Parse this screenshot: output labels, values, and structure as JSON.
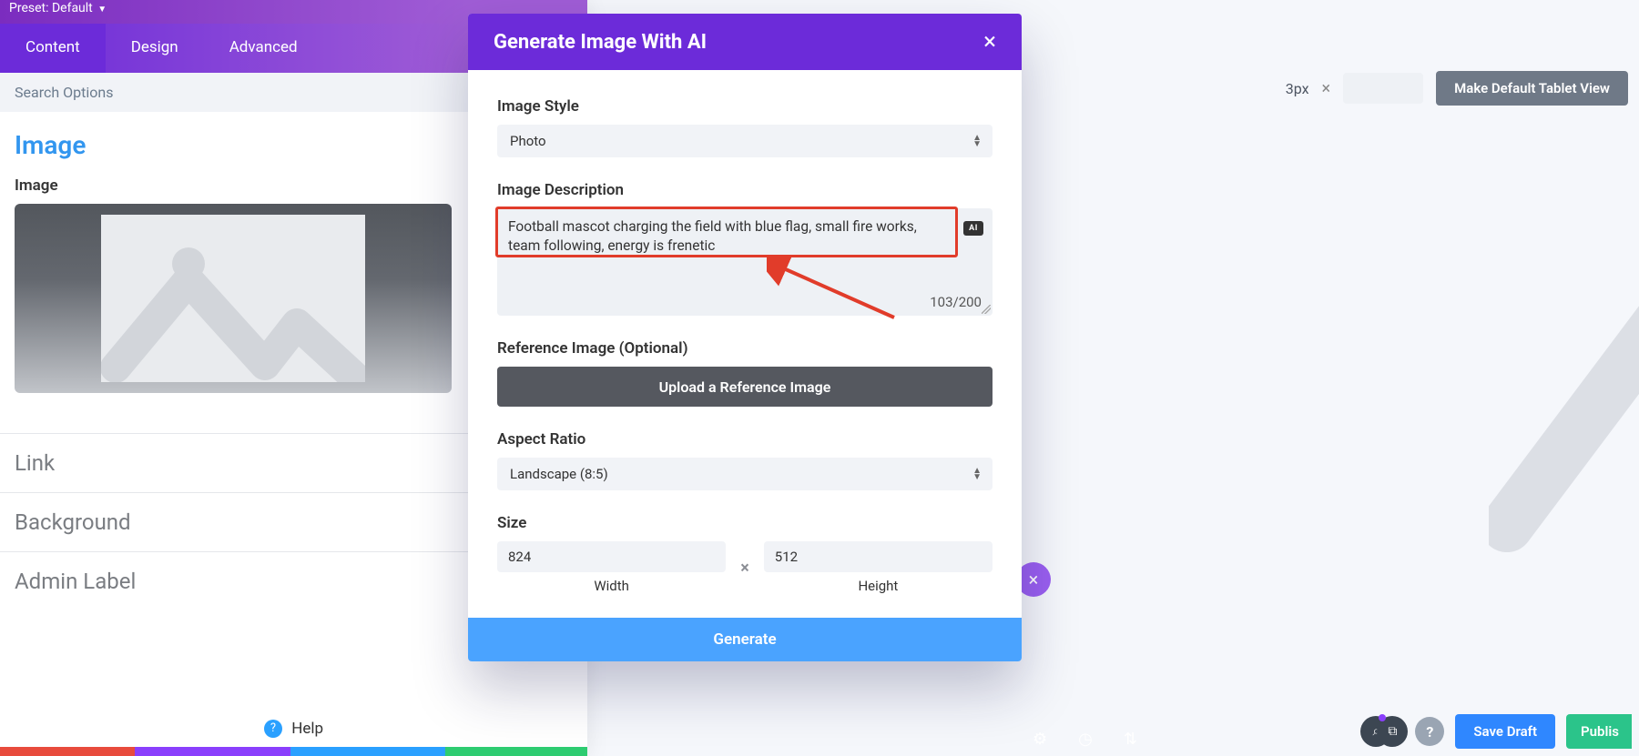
{
  "sidebar": {
    "preset_label": "Preset: Default",
    "tabs": {
      "content": "Content",
      "design": "Design",
      "advanced": "Advanced"
    },
    "search_placeholder": "Search Options",
    "section_title": "Image",
    "image_label": "Image",
    "collapse": {
      "link": "Link",
      "background": "Background",
      "admin_label": "Admin Label"
    },
    "help": "Help"
  },
  "modal": {
    "title": "Generate Image With AI",
    "style_label": "Image Style",
    "style_value": "Photo",
    "desc_label": "Image Description",
    "desc_value": "Football mascot charging the field with blue flag, small fire works, team following, energy is frenetic",
    "ai_badge": "AI",
    "char_count": "103/200",
    "ref_label": "Reference Image (Optional)",
    "upload_btn": "Upload a Reference Image",
    "ratio_label": "Aspect Ratio",
    "ratio_value": "Landscape (8:5)",
    "size_label": "Size",
    "width_value": "824",
    "height_value": "512",
    "width_sublabel": "Width",
    "height_sublabel": "Height",
    "generate_btn": "Generate"
  },
  "topbar": {
    "px_suffix": "3px",
    "default_view_btn": "Make Default Tablet View"
  },
  "bottombar": {
    "save_draft": "Save Draft",
    "publish": "Publis"
  }
}
